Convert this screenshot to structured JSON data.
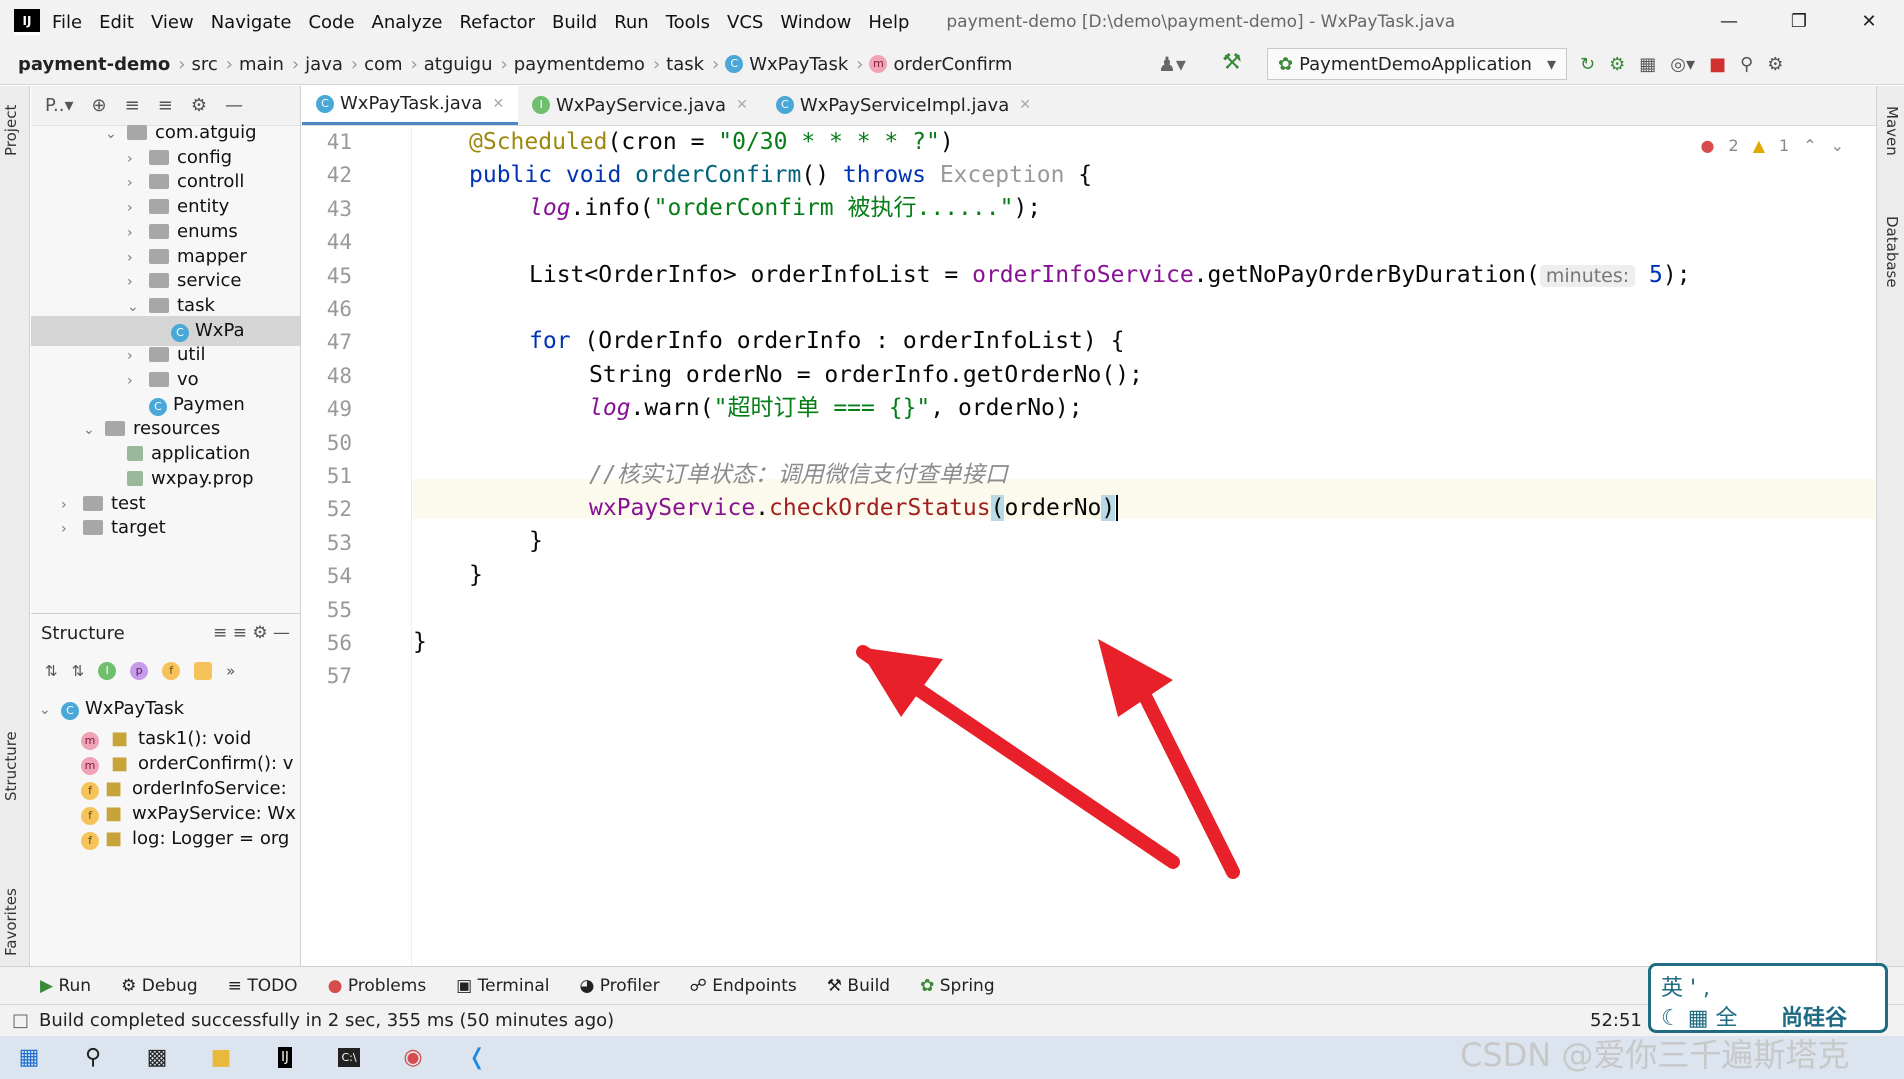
{
  "menubar": {
    "logo": "IJ",
    "items": [
      "File",
      "Edit",
      "View",
      "Navigate",
      "Code",
      "Analyze",
      "Refactor",
      "Build",
      "Run",
      "Tools",
      "VCS",
      "Window",
      "Help"
    ],
    "window_title": "payment-demo [D:\\demo\\payment-demo] - WxPayTask.java"
  },
  "navbar": {
    "breadcrumbs": [
      "payment-demo",
      "src",
      "main",
      "java",
      "com",
      "atguigu",
      "paymentdemo",
      "task",
      "WxPayTask",
      "orderConfirm"
    ],
    "run_config": "PaymentDemoApplication"
  },
  "project": {
    "toolbar_label": "P..▾",
    "tree": [
      {
        "label": "com.atguig",
        "indent": 2,
        "type": "folder",
        "expanded": true
      },
      {
        "label": "config",
        "indent": 3,
        "type": "folder"
      },
      {
        "label": "controll",
        "indent": 3,
        "type": "folder"
      },
      {
        "label": "entity",
        "indent": 3,
        "type": "folder"
      },
      {
        "label": "enums",
        "indent": 3,
        "type": "folder"
      },
      {
        "label": "mapper",
        "indent": 3,
        "type": "folder"
      },
      {
        "label": "service",
        "indent": 3,
        "type": "folder"
      },
      {
        "label": "task",
        "indent": 3,
        "type": "folder",
        "expanded": true
      },
      {
        "label": "WxPa",
        "indent": 4,
        "type": "class",
        "selected": true
      },
      {
        "label": "util",
        "indent": 3,
        "type": "folder"
      },
      {
        "label": "vo",
        "indent": 3,
        "type": "folder"
      },
      {
        "label": "Paymen",
        "indent": 3,
        "type": "class"
      },
      {
        "label": "resources",
        "indent": 1,
        "type": "folder",
        "expanded": true
      },
      {
        "label": "application",
        "indent": 2,
        "type": "file"
      },
      {
        "label": "wxpay.prop",
        "indent": 2,
        "type": "file"
      },
      {
        "label": "test",
        "indent": 0,
        "type": "folder"
      },
      {
        "label": "target",
        "indent": 0,
        "type": "folder"
      }
    ]
  },
  "structure": {
    "title": "Structure",
    "root": "WxPayTask",
    "members": [
      {
        "icon": "m",
        "label": "task1(): void"
      },
      {
        "icon": "m",
        "label": "orderConfirm(): v"
      },
      {
        "icon": "f",
        "label": "orderInfoService:"
      },
      {
        "icon": "f",
        "label": "wxPayService: Wx"
      },
      {
        "icon": "f",
        "label": "log: Logger = org"
      }
    ]
  },
  "side_tabs": {
    "project": "Project",
    "structure": "Structure",
    "favorites": "Favorites",
    "maven": "Maven",
    "database": "Database"
  },
  "tabs": [
    "WxPayTask.java",
    "WxPayService.java",
    "WxPayServiceImpl.java"
  ],
  "inspections": {
    "errors": "2",
    "warnings": "1"
  },
  "code": {
    "line_numbers": [
      "41",
      "42",
      "43",
      "44",
      "45",
      "46",
      "47",
      "48",
      "49",
      "50",
      "51",
      "52",
      "53",
      "54",
      "55",
      "56",
      "57"
    ],
    "l41_anno": "@Scheduled",
    "l41_a": "(cron = ",
    "l41_str": "\"0/30 * * * * ?\"",
    "l41_b": ")",
    "l42_kw1": "public void ",
    "l42_name": "orderConfirm",
    "l42_a": "() ",
    "l42_kw2": "throws ",
    "l42_exc": "Exception",
    "l42_b": " {",
    "l43_log": "log",
    "l43_a": ".info(",
    "l43_str": "\"orderConfirm 被执行......\"",
    "l43_b": ");",
    "l45_a": "List<OrderInfo> orderInfoList = ",
    "l45_fld": "orderInfoService",
    "l45_b": ".getNoPayOrderByDuration(",
    "l45_hint": "minutes:",
    "l45_num": "5",
    "l45_c": ");",
    "l47_kw": "for ",
    "l47_a": "(OrderInfo orderInfo : orderInfoList) {",
    "l48_a": "String orderNo = orderInfo.getOrderNo();",
    "l49_log": "log",
    "l49_a": ".warn(",
    "l49_str": "\"超时订单 === {}\"",
    "l49_b": ", orderNo);",
    "l51_cm": "//核实订单状态：调用微信支付查单接口",
    "l52_fld": "wxPayService",
    "l52_a": ".",
    "l52_mth": "checkOrderStatus",
    "l52_p1": "(",
    "l52_b": "orderNo",
    "l52_p2": ")",
    "l53": "}",
    "l54": "}",
    "l56": "}"
  },
  "bottom_tabs": [
    "Run",
    "Debug",
    "TODO",
    "Problems",
    "Terminal",
    "Profiler",
    "Endpoints",
    "Build",
    "Spring"
  ],
  "status": {
    "message": "Build completed successfully in 2 sec, 355 ms (50 minutes ago)",
    "position": "52:51"
  },
  "ime": {
    "line1": "英 ' ,",
    "line2": "全",
    "brand": "尚硅谷"
  },
  "watermark": "CSDN @爱你三千遍斯塔克",
  "colors": {
    "keyword": "#0033b3",
    "string": "#067d17",
    "field": "#871094",
    "annotation": "#9e880d",
    "arrow": "#e8202a"
  }
}
